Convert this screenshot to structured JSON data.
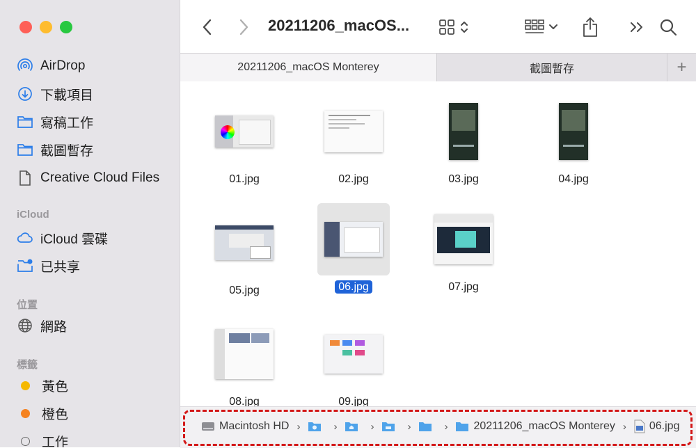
{
  "window": {
    "title": "20211206_macOS...",
    "traffic_colors": {
      "close": "#fe5f57",
      "minimize": "#febc2e",
      "zoom": "#28c840"
    }
  },
  "sidebar": {
    "favorites": [
      {
        "label": "AirDrop",
        "icon": "airdrop-icon"
      },
      {
        "label": "下載項目",
        "icon": "download-icon"
      },
      {
        "label": "寫稿工作",
        "icon": "folder-icon"
      },
      {
        "label": "截圖暫存",
        "icon": "folder-icon"
      },
      {
        "label": "Creative Cloud Files",
        "icon": "document-icon"
      }
    ],
    "icloud_header": "iCloud",
    "icloud": [
      {
        "label": "iCloud 雲碟",
        "icon": "cloud-icon"
      },
      {
        "label": "已共享",
        "icon": "shared-folder-icon"
      }
    ],
    "locations_header": "位置",
    "locations": [
      {
        "label": "網路",
        "icon": "globe-icon"
      }
    ],
    "tags_header": "標籤",
    "tags": [
      {
        "label": "黃色",
        "color": "#f5b800"
      },
      {
        "label": "橙色",
        "color": "#f5821f"
      },
      {
        "label": "工作",
        "color": ""
      }
    ],
    "accent_color": "#1f63d8"
  },
  "tabs": [
    {
      "label": "20211206_macOS Monterey",
      "active": true
    },
    {
      "label": "截圖暫存",
      "active": false
    }
  ],
  "files": [
    {
      "name": "01.jpg",
      "selected": false
    },
    {
      "name": "02.jpg",
      "selected": false
    },
    {
      "name": "03.jpg",
      "selected": false
    },
    {
      "name": "04.jpg",
      "selected": false
    },
    {
      "name": "05.jpg",
      "selected": false
    },
    {
      "name": "06.jpg",
      "selected": true
    },
    {
      "name": "07.jpg",
      "selected": false
    },
    {
      "name": "08.jpg",
      "selected": false
    },
    {
      "name": "09.jpg",
      "selected": false
    }
  ],
  "pathbar": {
    "root": "Macintosh HD",
    "folder": "20211206_macOS Monterey",
    "file": "06.jpg",
    "separator": "›"
  }
}
